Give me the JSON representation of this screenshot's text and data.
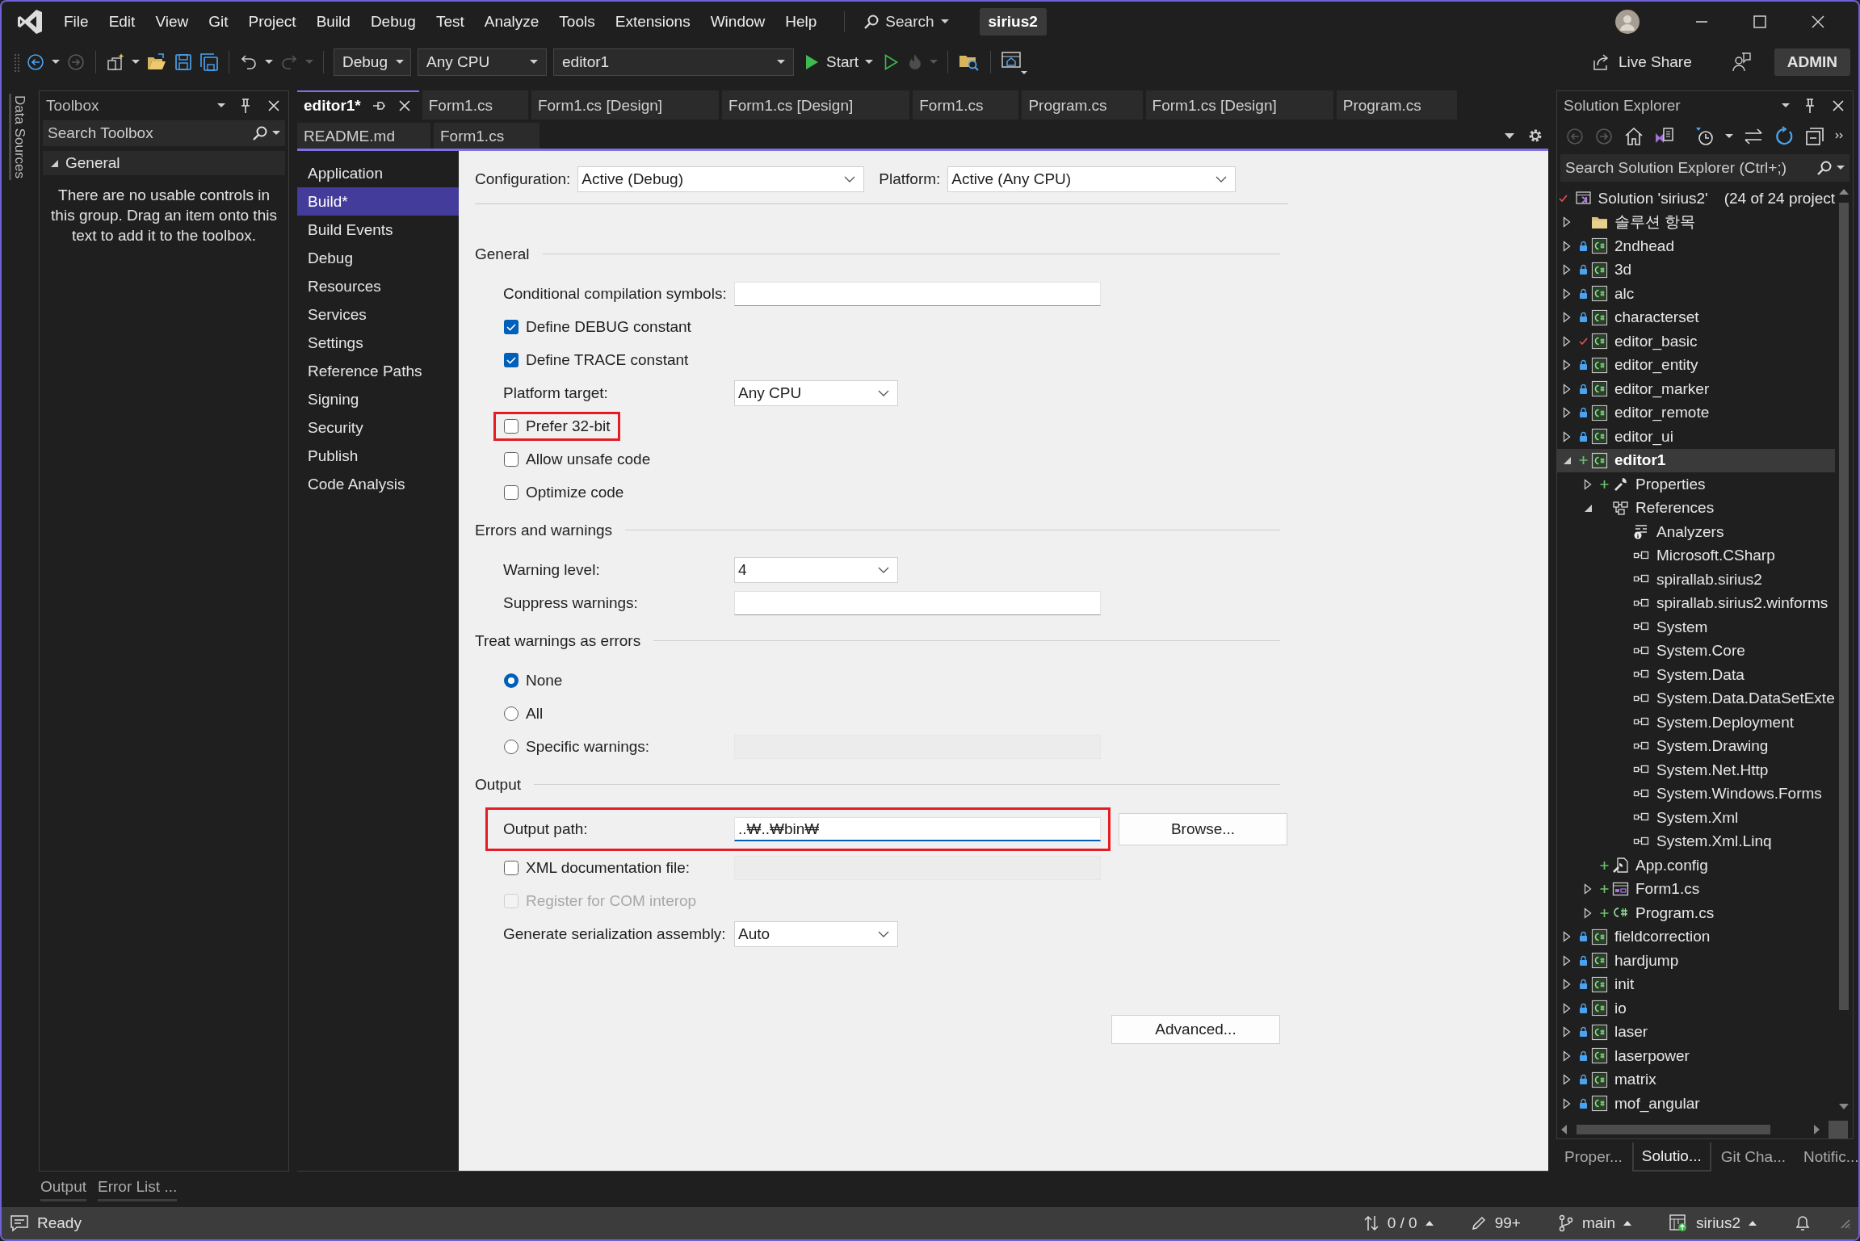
{
  "menu": {
    "items": [
      "File",
      "Edit",
      "View",
      "Git",
      "Project",
      "Build",
      "Debug",
      "Test",
      "Analyze",
      "Tools",
      "Extensions",
      "Window",
      "Help"
    ],
    "search": "Search",
    "solution_name": "sirius2"
  },
  "toolbar": {
    "configuration": "Debug",
    "platform": "Any CPU",
    "startup_project": "editor1",
    "start": "Start",
    "live_share": "Live Share",
    "account": "ADMIN"
  },
  "side_strip": {
    "label": "Data Sources"
  },
  "toolbox": {
    "title": "Toolbox",
    "search": {
      "placeholder": "Search Toolbox"
    },
    "group": {
      "label": "General",
      "expanded": true
    },
    "message": "There are no usable controls in this group. Drag an item onto this text to add it to the toolbox."
  },
  "editor": {
    "tab_rows": [
      [
        {
          "label": "editor1*",
          "selected": true
        },
        {
          "label": "Form1.cs",
          "selected": false
        },
        {
          "label": "Form1.cs [Design]",
          "selected": false
        },
        {
          "label": "Form1.cs [Design]",
          "selected": false
        },
        {
          "label": "Form1.cs",
          "selected": false
        },
        {
          "label": "Program.cs",
          "selected": false
        },
        {
          "label": "Form1.cs [Design]",
          "selected": false
        },
        {
          "label": "Program.cs",
          "selected": false
        }
      ],
      [
        {
          "label": "README.md",
          "selected": false
        },
        {
          "label": "Form1.cs",
          "selected": false
        }
      ]
    ]
  },
  "property_page": {
    "nav": [
      {
        "label": "Application",
        "selected": false
      },
      {
        "label": "Build*",
        "selected": true
      },
      {
        "label": "Build Events",
        "selected": false
      },
      {
        "label": "Debug",
        "selected": false
      },
      {
        "label": "Resources",
        "selected": false
      },
      {
        "label": "Services",
        "selected": false
      },
      {
        "label": "Settings",
        "selected": false
      },
      {
        "label": "Reference Paths",
        "selected": false
      },
      {
        "label": "Signing",
        "selected": false
      },
      {
        "label": "Security",
        "selected": false
      },
      {
        "label": "Publish",
        "selected": false
      },
      {
        "label": "Code Analysis",
        "selected": false
      }
    ],
    "configuration": {
      "label": "Configuration:",
      "value": "Active (Debug)"
    },
    "platform": {
      "label": "Platform:",
      "value": "Active (Any CPU)"
    },
    "sections": [
      {
        "title": "General",
        "rows": [
          {
            "kind": "text",
            "label": "Conditional compilation symbols:",
            "highlighted": false,
            "disabled": false,
            "focused": false
          },
          {
            "kind": "checkbox",
            "label": "Define DEBUG constant",
            "checked": true,
            "highlighted": false,
            "disabled": false
          },
          {
            "kind": "checkbox",
            "label": "Define TRACE constant",
            "checked": true,
            "highlighted": false,
            "disabled": false
          },
          {
            "kind": "dropdown",
            "label": "Platform target:",
            "value": "Any CPU",
            "highlighted": false,
            "disabled": false
          },
          {
            "kind": "checkbox",
            "label": "Prefer 32-bit",
            "checked": false,
            "highlighted": true,
            "disabled": false
          },
          {
            "kind": "checkbox",
            "label": "Allow unsafe code",
            "checked": false,
            "highlighted": false,
            "disabled": false
          },
          {
            "kind": "checkbox",
            "label": "Optimize code",
            "checked": false,
            "highlighted": false,
            "disabled": false
          }
        ]
      },
      {
        "title": "Errors and warnings",
        "rows": [
          {
            "kind": "dropdown",
            "label": "Warning level:",
            "value": "4",
            "highlighted": false,
            "disabled": false
          },
          {
            "kind": "text",
            "label": "Suppress warnings:",
            "highlighted": false,
            "disabled": false,
            "focused": false
          }
        ]
      },
      {
        "title": "Treat warnings as errors",
        "rows": [
          {
            "kind": "radio",
            "label": "None",
            "selected": true,
            "highlighted": false,
            "disabled": false
          },
          {
            "kind": "radio",
            "label": "All",
            "selected": false,
            "highlighted": false,
            "disabled": false
          },
          {
            "kind": "radio-text",
            "label": "Specific warnings:",
            "selected": false,
            "highlighted": false,
            "disabled": true
          }
        ]
      },
      {
        "title": "Output",
        "rows": [
          {
            "kind": "text",
            "label": "Output path:",
            "value": "..₩..₩bin₩",
            "button": "Browse...",
            "highlighted": true,
            "disabled": false,
            "focused": true
          },
          {
            "kind": "checkbox-text",
            "label": "XML documentation file:",
            "checked": false,
            "highlighted": false,
            "disabled": true
          },
          {
            "kind": "checkbox",
            "label": "Register for COM interop",
            "checked": false,
            "highlighted": false,
            "disabled": true
          },
          {
            "kind": "dropdown",
            "label": "Generate serialization assembly:",
            "value": "Auto",
            "highlighted": false,
            "disabled": false
          }
        ]
      }
    ],
    "advanced_button": "Advanced..."
  },
  "solution_explorer": {
    "title": "Solution Explorer",
    "search": {
      "placeholder": "Search Solution Explorer (Ctrl+;)"
    },
    "tree": {
      "label": "Solution 'sirius2'",
      "detail": "(24 of 24 project",
      "kind": "solution",
      "checked_out": true,
      "selected": false,
      "children": [
        {
          "label": "솔루션 항목",
          "kind": "folder",
          "locked": false,
          "checked_out": false,
          "pending_add": false,
          "expanded": false,
          "selected": false
        },
        {
          "label": "2ndhead",
          "kind": "project",
          "locked": true,
          "checked_out": false,
          "pending_add": false,
          "expanded": false,
          "selected": false
        },
        {
          "label": "3d",
          "kind": "project",
          "locked": true,
          "checked_out": false,
          "pending_add": false,
          "expanded": false,
          "selected": false
        },
        {
          "label": "alc",
          "kind": "project",
          "locked": true,
          "checked_out": false,
          "pending_add": false,
          "expanded": false,
          "selected": false
        },
        {
          "label": "characterset",
          "kind": "project",
          "locked": true,
          "checked_out": false,
          "pending_add": false,
          "expanded": false,
          "selected": false
        },
        {
          "label": "editor_basic",
          "kind": "project",
          "locked": false,
          "checked_out": true,
          "pending_add": false,
          "expanded": false,
          "selected": false
        },
        {
          "label": "editor_entity",
          "kind": "project",
          "locked": true,
          "checked_out": false,
          "pending_add": false,
          "expanded": false,
          "selected": false
        },
        {
          "label": "editor_marker",
          "kind": "project",
          "locked": true,
          "checked_out": false,
          "pending_add": false,
          "expanded": false,
          "selected": false
        },
        {
          "label": "editor_remote",
          "kind": "project",
          "locked": true,
          "checked_out": false,
          "pending_add": false,
          "expanded": false,
          "selected": false
        },
        {
          "label": "editor_ui",
          "kind": "project",
          "locked": true,
          "checked_out": false,
          "pending_add": false,
          "expanded": false,
          "selected": false
        },
        {
          "label": "editor1",
          "kind": "project",
          "locked": false,
          "checked_out": false,
          "pending_add": true,
          "expanded": true,
          "selected": true,
          "children": [
            {
              "label": "Properties",
              "kind": "properties",
              "pending_add": true,
              "expanded": false,
              "selected": false
            },
            {
              "label": "References",
              "kind": "references",
              "pending_add": false,
              "expanded": true,
              "selected": false,
              "children": [
                {
                  "label": "Analyzers",
                  "kind": "analyzers",
                  "selected": false
                },
                {
                  "label": "Microsoft.CSharp",
                  "kind": "reference",
                  "selected": false
                },
                {
                  "label": "spirallab.sirius2",
                  "kind": "reference",
                  "selected": false
                },
                {
                  "label": "spirallab.sirius2.winforms",
                  "kind": "reference",
                  "selected": false
                },
                {
                  "label": "System",
                  "kind": "reference",
                  "selected": false
                },
                {
                  "label": "System.Core",
                  "kind": "reference",
                  "selected": false
                },
                {
                  "label": "System.Data",
                  "kind": "reference",
                  "selected": false
                },
                {
                  "label": "System.Data.DataSetExte",
                  "kind": "reference",
                  "selected": false
                },
                {
                  "label": "System.Deployment",
                  "kind": "reference",
                  "selected": false
                },
                {
                  "label": "System.Drawing",
                  "kind": "reference",
                  "selected": false
                },
                {
                  "label": "System.Net.Http",
                  "kind": "reference",
                  "selected": false
                },
                {
                  "label": "System.Windows.Forms",
                  "kind": "reference",
                  "selected": false
                },
                {
                  "label": "System.Xml",
                  "kind": "reference",
                  "selected": false
                },
                {
                  "label": "System.Xml.Linq",
                  "kind": "reference",
                  "selected": false
                }
              ]
            },
            {
              "label": "App.config",
              "kind": "config",
              "pending_add": true,
              "selected": false
            },
            {
              "label": "Form1.cs",
              "kind": "form",
              "pending_add": true,
              "expanded": false,
              "selected": false
            },
            {
              "label": "Program.cs",
              "kind": "code",
              "pending_add": true,
              "expanded": false,
              "selected": false
            }
          ]
        },
        {
          "label": "fieldcorrection",
          "kind": "project",
          "locked": true,
          "checked_out": false,
          "pending_add": false,
          "expanded": false,
          "selected": false
        },
        {
          "label": "hardjump",
          "kind": "project",
          "locked": true,
          "checked_out": false,
          "pending_add": false,
          "expanded": false,
          "selected": false
        },
        {
          "label": "init",
          "kind": "project",
          "locked": true,
          "checked_out": false,
          "pending_add": false,
          "expanded": false,
          "selected": false
        },
        {
          "label": "io",
          "kind": "project",
          "locked": true,
          "checked_out": false,
          "pending_add": false,
          "expanded": false,
          "selected": false
        },
        {
          "label": "laser",
          "kind": "project",
          "locked": true,
          "checked_out": false,
          "pending_add": false,
          "expanded": false,
          "selected": false
        },
        {
          "label": "laserpower",
          "kind": "project",
          "locked": true,
          "checked_out": false,
          "pending_add": false,
          "expanded": false,
          "selected": false
        },
        {
          "label": "matrix",
          "kind": "project",
          "locked": true,
          "checked_out": false,
          "pending_add": false,
          "expanded": false,
          "selected": false
        },
        {
          "label": "mof_angular",
          "kind": "project",
          "locked": true,
          "checked_out": false,
          "pending_add": false,
          "expanded": false,
          "selected": false
        }
      ]
    },
    "tabs": [
      {
        "label": "Proper...",
        "selected": false
      },
      {
        "label": "Solutio...",
        "selected": true
      },
      {
        "label": "Git Cha...",
        "selected": false
      },
      {
        "label": "Notific...",
        "selected": false
      }
    ]
  },
  "bottom_tabs": [
    "Output",
    "Error List ..."
  ],
  "status_bar": {
    "message": "Ready",
    "changes": "0 / 0",
    "edits": "99+",
    "branch": "main",
    "repository": "sirius2"
  }
}
